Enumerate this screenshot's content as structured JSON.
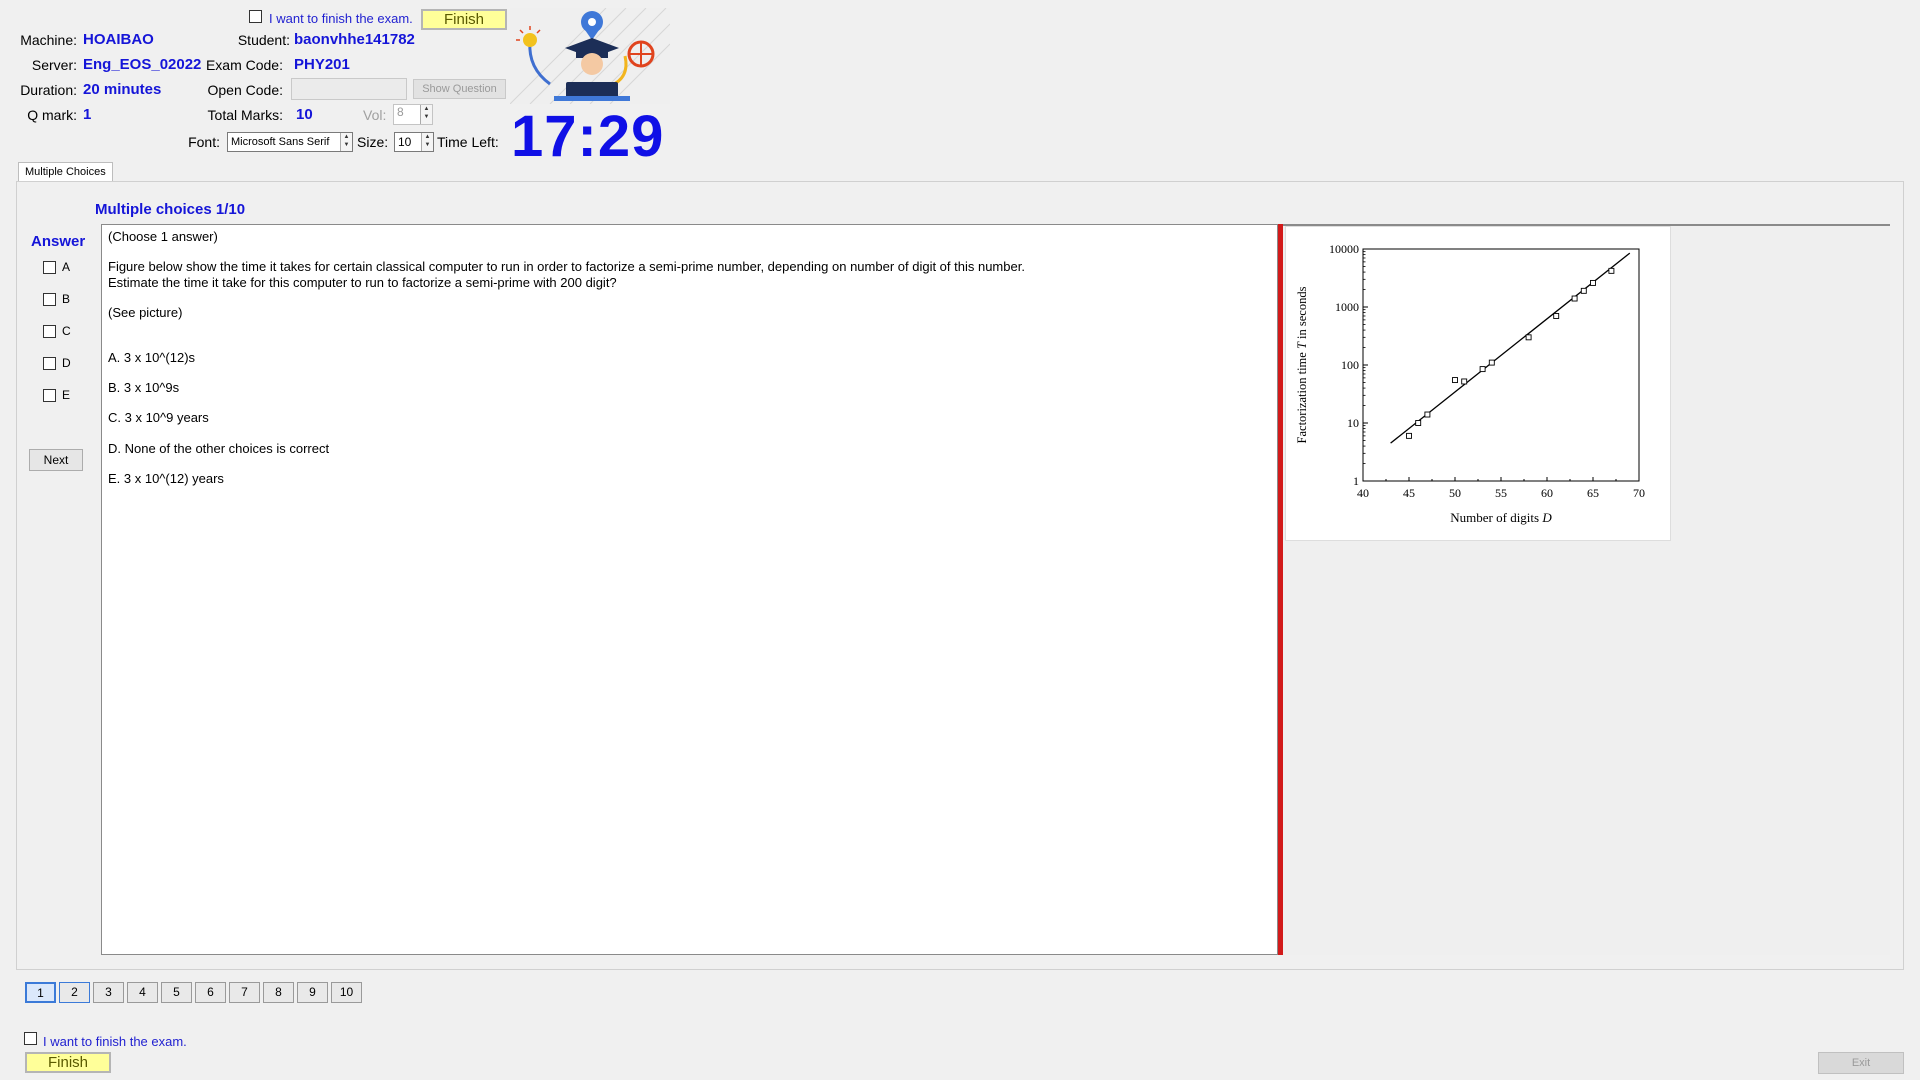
{
  "header": {
    "finish_check_label": "I want to finish the exam.",
    "finish_label": "Finish",
    "machine_label": "Machine:",
    "machine_value": "HOAIBAO",
    "server_label": "Server:",
    "server_value": "Eng_EOS_02022",
    "duration_label": "Duration:",
    "duration_value": "20 minutes",
    "qmark_label": "Q mark:",
    "qmark_value": "1",
    "student_label": "Student:",
    "student_value": "baonvhhe141782",
    "exam_code_label": "Exam Code:",
    "exam_code_value": "PHY201",
    "open_code_label": "Open Code:",
    "open_code_value": "",
    "show_question_label": "Show Question",
    "total_marks_label": "Total Marks:",
    "total_marks_value": "10",
    "vol_label": "Vol:",
    "vol_value": "8",
    "font_label": "Font:",
    "font_value": "Microsoft Sans Serif",
    "size_label": "Size:",
    "size_value": "10",
    "time_left_label": "Time Left:",
    "timer": "17:29"
  },
  "tabs": [
    {
      "label": "Multiple Choices"
    }
  ],
  "question": {
    "header": "Multiple choices 1/10",
    "answer_label": "Answer",
    "options": [
      "A",
      "B",
      "C",
      "D",
      "E"
    ],
    "next_label": "Next",
    "choose": "(Choose 1 answer)",
    "text_line1": "Figure below show the time it takes for certain classical computer to run in order to factorize a semi-prime number, depending on number of digit of this number.",
    "text_line2": "Estimate the time it take for this computer to run to factorize a semi-prime with 200 digit?",
    "see_picture": "(See picture)",
    "choices": [
      "A.  3 x 10^(12)s",
      "B.  3 x 10^9s",
      "C.  3 x 10^9 years",
      "D.  None of the other choices is correct",
      "E.  3 x 10^(12) years"
    ]
  },
  "chart_data": {
    "type": "scatter",
    "xlabel_prefix": "Number of digits ",
    "xlabel_var": "D",
    "ylabel_prefix": "Factorization time ",
    "ylabel_var": "T",
    "ylabel_suffix": " in seconds",
    "xlim": [
      40,
      70
    ],
    "ylim": [
      1,
      10000
    ],
    "yscale": "log",
    "x_ticks": [
      "40",
      "45",
      "50",
      "55",
      "60",
      "65",
      "70"
    ],
    "y_ticks": [
      "1",
      "10",
      "100",
      "1000",
      "10000"
    ],
    "points": [
      {
        "x": 45,
        "y": 6
      },
      {
        "x": 46,
        "y": 10
      },
      {
        "x": 47,
        "y": 14
      },
      {
        "x": 50,
        "y": 55
      },
      {
        "x": 51,
        "y": 52
      },
      {
        "x": 53,
        "y": 85
      },
      {
        "x": 54,
        "y": 110
      },
      {
        "x": 58,
        "y": 300
      },
      {
        "x": 61,
        "y": 700
      },
      {
        "x": 63,
        "y": 1400
      },
      {
        "x": 64,
        "y": 1900
      },
      {
        "x": 65,
        "y": 2600
      },
      {
        "x": 67,
        "y": 4200
      }
    ],
    "fit_line": [
      {
        "x": 43,
        "y": 4.5
      },
      {
        "x": 69,
        "y": 8500
      }
    ]
  },
  "pagination": [
    "1",
    "2",
    "3",
    "4",
    "5",
    "6",
    "7",
    "8",
    "9",
    "10"
  ],
  "footer": {
    "finish_check_label": "I want to finish the exam.",
    "finish_label": "Finish",
    "exit_label": "Exit"
  }
}
